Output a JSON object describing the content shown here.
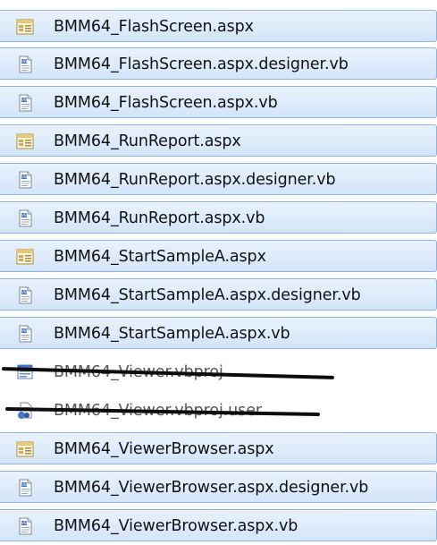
{
  "files": [
    {
      "name": "BMM64_FlashScreen.aspx",
      "icon": "aspx-page-icon",
      "selected": true
    },
    {
      "name": "BMM64_FlashScreen.aspx.designer.vb",
      "icon": "vb-file-icon",
      "selected": true
    },
    {
      "name": "BMM64_FlashScreen.aspx.vb",
      "icon": "vb-file-icon",
      "selected": true
    },
    {
      "name": "BMM64_RunReport.aspx",
      "icon": "aspx-page-icon",
      "selected": true
    },
    {
      "name": "BMM64_RunReport.aspx.designer.vb",
      "icon": "vb-file-icon",
      "selected": true
    },
    {
      "name": "BMM64_RunReport.aspx.vb",
      "icon": "vb-file-icon",
      "selected": true
    },
    {
      "name": "BMM64_StartSampleA.aspx",
      "icon": "aspx-page-icon",
      "selected": true
    },
    {
      "name": "BMM64_StartSampleA.aspx.designer.vb",
      "icon": "vb-file-icon",
      "selected": true
    },
    {
      "name": "BMM64_StartSampleA.aspx.vb",
      "icon": "vb-file-icon",
      "selected": true
    },
    {
      "name": "BMM64_Viewer.vbproj",
      "icon": "vbproj-file-icon",
      "selected": false,
      "struck": true
    },
    {
      "name": "BMM64_Viewer.vbproj.user",
      "icon": "vbproj-user-file-icon",
      "selected": false,
      "struck": true
    },
    {
      "name": "BMM64_ViewerBrowser.aspx",
      "icon": "aspx-page-icon",
      "selected": true
    },
    {
      "name": "BMM64_ViewerBrowser.aspx.designer.vb",
      "icon": "vb-file-icon",
      "selected": true
    },
    {
      "name": "BMM64_ViewerBrowser.aspx.vb",
      "icon": "vb-file-icon",
      "selected": true
    }
  ]
}
